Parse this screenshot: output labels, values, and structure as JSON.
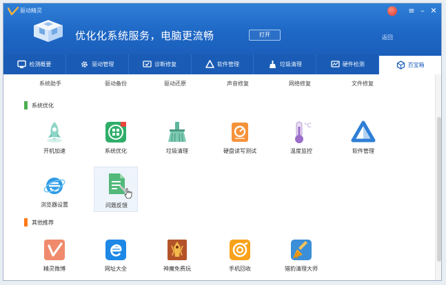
{
  "app": {
    "title": "驱动精灵",
    "slogan": "优化化系统服务，电脑更流畅",
    "open_label": "打开",
    "back_label": "返回"
  },
  "tabs": [
    {
      "label": "检测概要",
      "icon": "monitor-icon",
      "active": false
    },
    {
      "label": "驱动管理",
      "icon": "gear-icon",
      "active": false
    },
    {
      "label": "诊断修复",
      "icon": "repair-icon",
      "active": false
    },
    {
      "label": "软件管理",
      "icon": "software-icon",
      "active": false
    },
    {
      "label": "垃圾清理",
      "icon": "broom-icon",
      "active": false
    },
    {
      "label": "硬件检测",
      "icon": "hardware-icon",
      "active": false
    },
    {
      "label": "百宝箱",
      "icon": "toolbox-icon",
      "active": true
    }
  ],
  "subtabs": [
    "系统助手",
    "驱动备份",
    "驱动还原",
    "声音修复",
    "网络修复",
    "文件修复"
  ],
  "sections": [
    {
      "title": "系统优化",
      "color": "#4caf50"
    },
    {
      "title": "其他推荐",
      "color": "#ff7a1a"
    }
  ],
  "tools": {
    "boot": "开机加速",
    "sysopt": "系统优化",
    "junk": "垃圾清理",
    "disk": "硬盘读写测试",
    "temp": "温度监控",
    "softmgr": "软件管理",
    "browser": "浏览器设置",
    "feedback": "问题反馈",
    "weibo": "精灵微博",
    "sites": "网址大全",
    "game": "神魔免费玩",
    "recycle": "手机回收",
    "master": "猎豹清理大师"
  },
  "colors": {
    "header": "#1f68c6",
    "tabbar": "#1a5cb5",
    "accent_green": "#4caf50",
    "accent_orange": "#ff7a1a"
  }
}
